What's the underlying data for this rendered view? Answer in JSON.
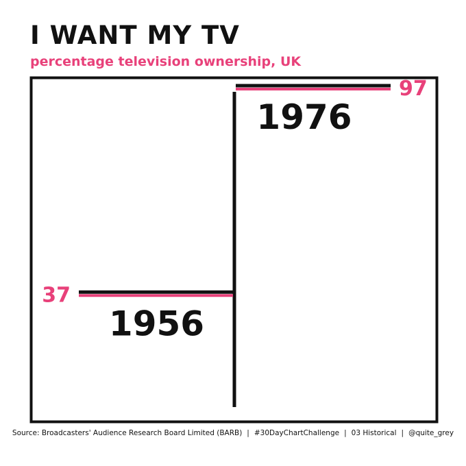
{
  "title": "I WANT MY TV",
  "subtitle": "percentage television ownership, UK",
  "colors": {
    "accent": "#e8417a",
    "ink": "#111111"
  },
  "footer": {
    "source": "Source: Broadcasters' Audience Research Board Limited (BARB)",
    "tag": "#30DayChartChallenge",
    "prompt": "03 Historical",
    "handle": "@quite_grey",
    "separator": "|"
  },
  "chart_data": {
    "type": "line",
    "x": [
      "1956",
      "1976"
    ],
    "values": [
      37,
      97
    ],
    "ylim": [
      0,
      100
    ],
    "grid": false,
    "legend": "none"
  }
}
